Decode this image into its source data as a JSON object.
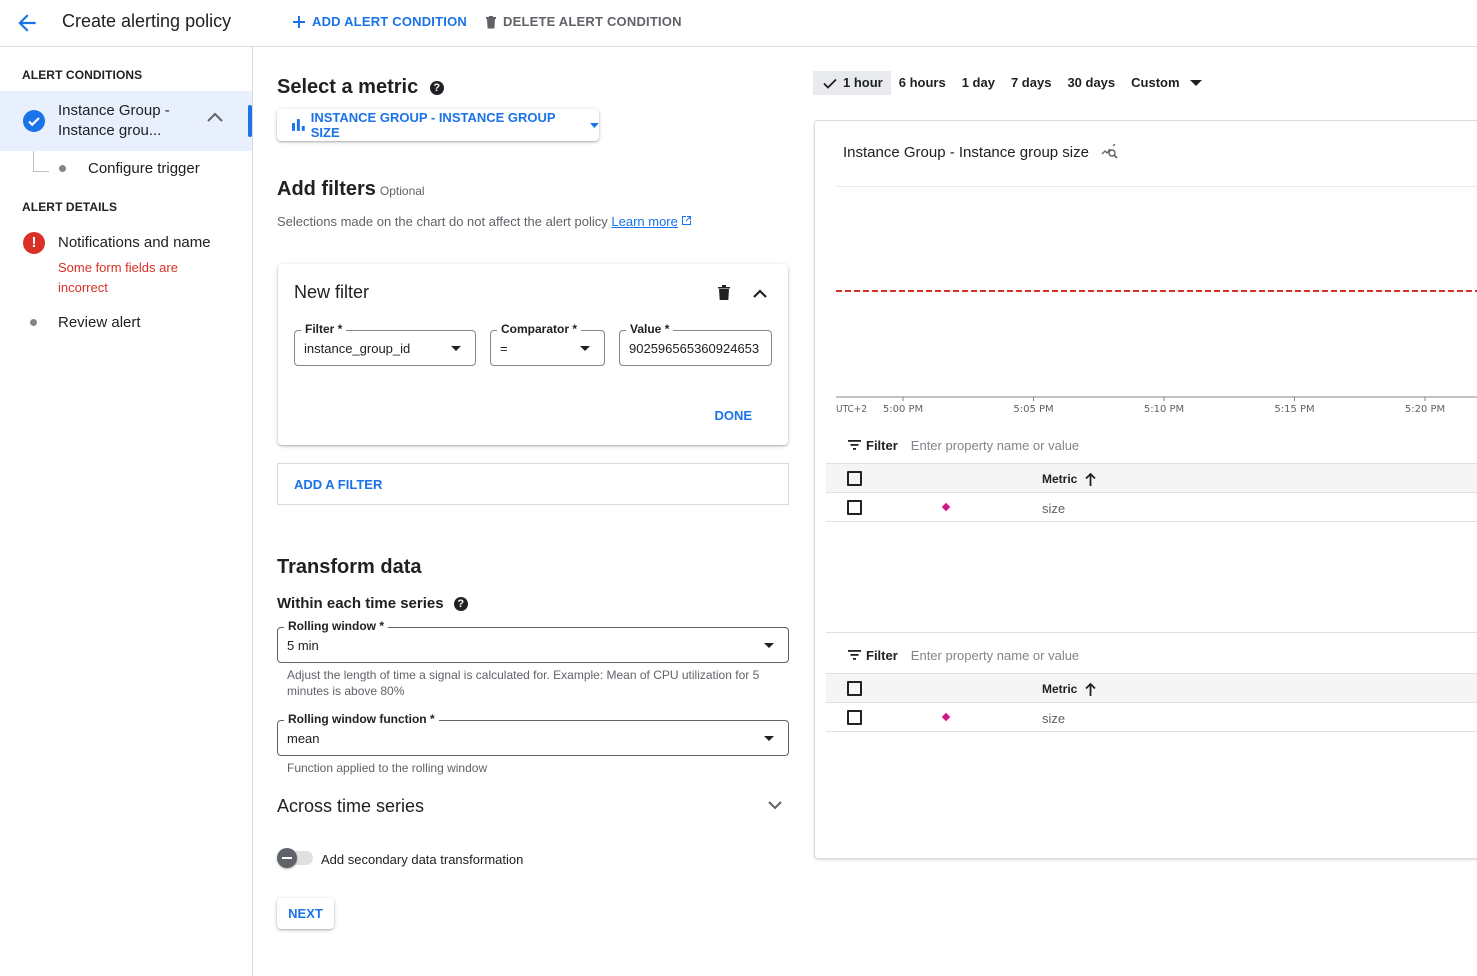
{
  "header": {
    "title": "Create alerting policy",
    "add_condition": "ADD ALERT CONDITION",
    "delete_condition": "DELETE ALERT CONDITION"
  },
  "sidebar": {
    "conditions_heading": "ALERT CONDITIONS",
    "condition_label": "Instance Group - Instance grou...",
    "configure_trigger": "Configure trigger",
    "details_heading": "ALERT DETAILS",
    "notifications": "Notifications and name",
    "notifications_error": "Some form fields are incorrect",
    "review": "Review alert"
  },
  "metric": {
    "heading": "Select a metric",
    "help": "?",
    "selected": "INSTANCE GROUP - INSTANCE GROUP SIZE"
  },
  "filters": {
    "heading": "Add filters",
    "optional": "Optional",
    "description": "Selections made on the chart do not affect the alert policy",
    "learn_more": "Learn more",
    "new_filter": {
      "title": "New filter",
      "filter_label": "Filter *",
      "filter_value": "instance_group_id",
      "comparator_label": "Comparator *",
      "comparator_value": "=",
      "value_label": "Value *",
      "value_value": "902596565360924653",
      "done": "DONE"
    },
    "add_filter": "ADD A FILTER"
  },
  "transform": {
    "heading": "Transform data",
    "within_heading": "Within each time series",
    "rolling_window_label": "Rolling window *",
    "rolling_window_value": "5 min",
    "rolling_window_hint": "Adjust the length of time a signal is calculated for. Example: Mean of CPU utilization for 5 minutes is above 80%",
    "rolling_function_label": "Rolling window function *",
    "rolling_function_value": "mean",
    "rolling_function_hint": "Function applied to the rolling window",
    "across_heading": "Across time series",
    "secondary_toggle_label": "Add secondary data transformation",
    "secondary_toggle_on": false,
    "next": "NEXT"
  },
  "time_range": {
    "options": [
      "1 hour",
      "6 hours",
      "1 day",
      "7 days",
      "30 days",
      "Custom"
    ],
    "selected": "1 hour"
  },
  "chart": {
    "title": "Instance Group - Instance group size",
    "timezone": "UTC+2",
    "threshold_color": "#d93025"
  },
  "chart_data": {
    "type": "line",
    "title": "Instance Group - Instance group size",
    "xlabel": "",
    "ylabel": "",
    "x_ticks": [
      "5:00 PM",
      "5:05 PM",
      "5:10 PM",
      "5:15 PM",
      "5:20 PM"
    ],
    "timezone_label": "UTC+2",
    "series": [
      {
        "name": "size",
        "color": "#d01884",
        "values": []
      }
    ],
    "threshold": {
      "style": "dashed",
      "color": "#d93025"
    },
    "grid": false
  },
  "legend_tables": [
    {
      "filter_label": "Filter",
      "filter_placeholder": "Enter property name or value",
      "column": "Metric",
      "rows": [
        {
          "metric": "size",
          "color": "#d01884"
        }
      ]
    },
    {
      "filter_label": "Filter",
      "filter_placeholder": "Enter property name or value",
      "column": "Metric",
      "rows": [
        {
          "metric": "size",
          "color": "#d01884"
        }
      ]
    }
  ]
}
